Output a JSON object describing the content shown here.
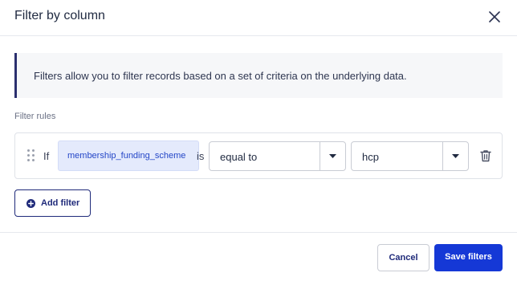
{
  "dialog": {
    "title": "Filter by column",
    "close_icon": "close-icon"
  },
  "info_banner": {
    "text": "Filters allow you to filter records based on a set of criteria on the underlying data."
  },
  "rules": {
    "label": "Filter rules",
    "items": [
      {
        "prefix": "If",
        "column": "membership_funding_scheme",
        "connector": "is",
        "operator": "equal to",
        "value": "hcp",
        "drag_icon": "drag-handle-icon",
        "delete_icon": "trash-icon"
      }
    ]
  },
  "actions": {
    "add_filter_label": "Add filter",
    "add_filter_icon": "plus-circle-icon",
    "cancel_label": "Cancel",
    "save_label": "Save filters"
  },
  "colors": {
    "primary": "#1538d6",
    "navy": "#1f2a7a",
    "chip_bg": "#e4eafc",
    "banner_accent": "#2a2f6e"
  }
}
